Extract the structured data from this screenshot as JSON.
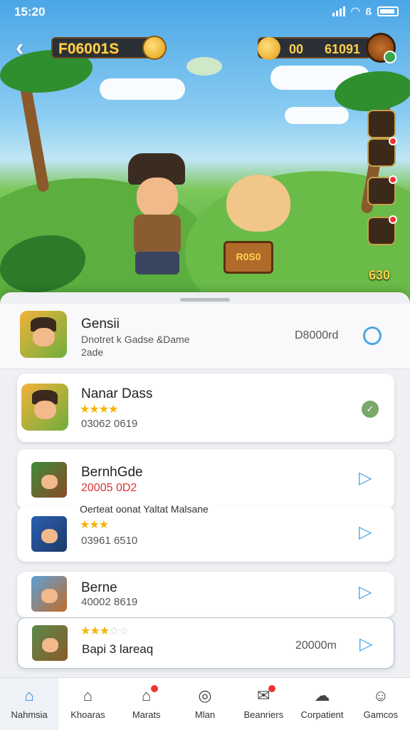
{
  "status_bar": {
    "time": "15:20"
  },
  "header": {
    "title": "F06001S",
    "currency_a": "00",
    "currency_b": "61091"
  },
  "scene": {
    "chest_text": "R0S0",
    "corner_number": "630"
  },
  "sheet": {
    "top_row": {
      "title": "Gensii",
      "line1": "Dnotret k Gadse &Dame",
      "line2": "2ade",
      "value": "D8000rd"
    },
    "cards": [
      {
        "title": "Nanar Dass",
        "stars": "★★★★",
        "sub": "03062 0619"
      },
      {
        "title": "BernhGde",
        "sub_red": "20005 0D2",
        "caption": "Oerteat oonat Yaltat Malsane"
      },
      {
        "stars": "★★★",
        "sub": "03961 6510"
      },
      {
        "title": "Berne",
        "sub": "40002 8619"
      },
      {
        "stars": "★★★",
        "stars_off": "☆☆",
        "title": "Bapi 3 lareaq",
        "value": "20000m"
      }
    ]
  },
  "nav": {
    "items": [
      {
        "label": "Nahmsia",
        "icon": "home-icon"
      },
      {
        "label": "Khoaras",
        "icon": "house-icon"
      },
      {
        "label": "Marats",
        "icon": "shop-icon"
      },
      {
        "label": "Mlan",
        "icon": "map-icon"
      },
      {
        "label": "Beanriers",
        "icon": "mail-icon"
      },
      {
        "label": "Corpatient",
        "icon": "cloud-icon"
      },
      {
        "label": "Gamcos",
        "icon": "profile-icon"
      }
    ]
  },
  "colors": {
    "accent": "#4aa6e6",
    "active_nav": "#2a88d8",
    "badge": "#e33333",
    "star": "#f4b400"
  }
}
